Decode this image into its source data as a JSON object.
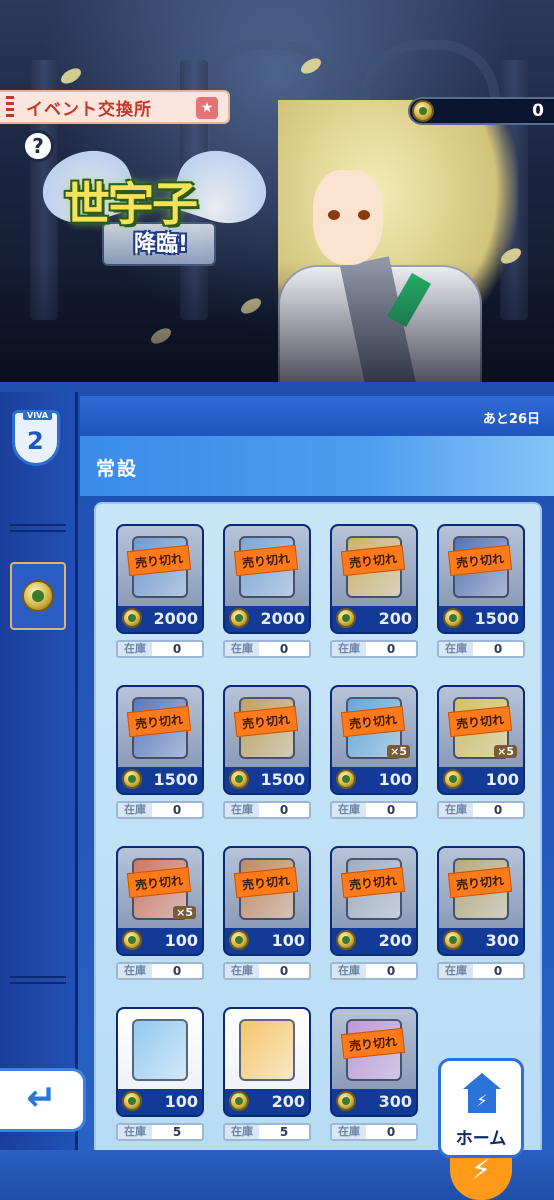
{
  "banner": {
    "event_tab": "イベント交換所",
    "help": "?",
    "currency_amount": "0",
    "logo_title": "世宇子",
    "logo_sub": "降臨!"
  },
  "shop": {
    "remaining": "あと26日",
    "section": "常設",
    "stock_label": "在庫",
    "sold_label": "売り切れ",
    "items": [
      {
        "price": "2000",
        "stock": "0",
        "sold": true,
        "mult": "",
        "color": "#5a8fd0"
      },
      {
        "price": "2000",
        "stock": "0",
        "sold": true,
        "mult": "",
        "color": "#6aa0d8"
      },
      {
        "price": "200",
        "stock": "0",
        "sold": true,
        "mult": "",
        "color": "#d9b04a"
      },
      {
        "price": "1500",
        "stock": "0",
        "sold": true,
        "mult": "",
        "color": "#3a5aa8"
      },
      {
        "price": "1500",
        "stock": "0",
        "sold": true,
        "mult": "",
        "color": "#3d62b5"
      },
      {
        "price": "1500",
        "stock": "0",
        "sold": true,
        "mult": "",
        "color": "#c69a3a"
      },
      {
        "price": "100",
        "stock": "0",
        "sold": true,
        "mult": "×5",
        "color": "#4aa3e0"
      },
      {
        "price": "100",
        "stock": "0",
        "sold": true,
        "mult": "×5",
        "color": "#e0c23a"
      },
      {
        "price": "100",
        "stock": "0",
        "sold": true,
        "mult": "×5",
        "color": "#d9603a"
      },
      {
        "price": "100",
        "stock": "0",
        "sold": true,
        "mult": "",
        "color": "#c97a3a"
      },
      {
        "price": "200",
        "stock": "0",
        "sold": true,
        "mult": "",
        "color": "#9aa8bd"
      },
      {
        "price": "300",
        "stock": "0",
        "sold": true,
        "mult": "",
        "color": "#b9a560"
      },
      {
        "price": "100",
        "stock": "5",
        "sold": false,
        "mult": "",
        "color": "#6fb9ec"
      },
      {
        "price": "200",
        "stock": "5",
        "sold": false,
        "mult": "",
        "color": "#f2b43a"
      },
      {
        "price": "300",
        "stock": "0",
        "sold": true,
        "mult": "",
        "color": "#c28fd8"
      }
    ]
  },
  "nav": {
    "back_icon": "↵",
    "home_label": "ホーム",
    "bolt_icon": "⚡"
  },
  "sidebar": {
    "emblem_tag": "VIVA",
    "emblem_mark": "2"
  }
}
